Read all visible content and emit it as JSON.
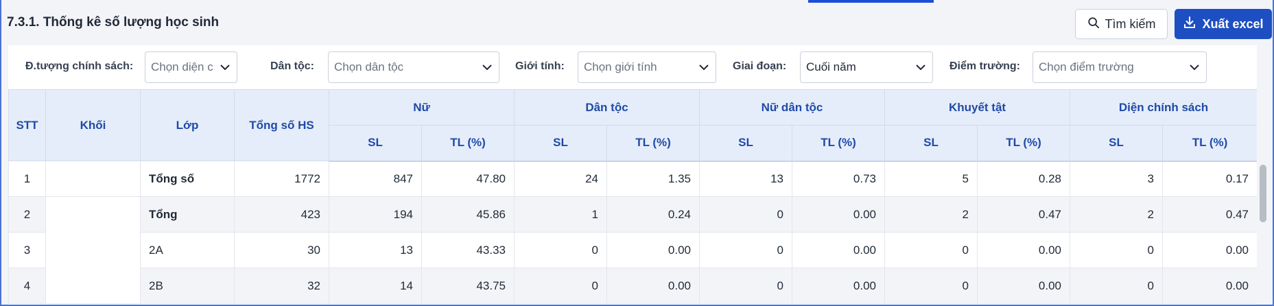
{
  "title": "7.3.1. Thống kê số lượng học sinh",
  "toolbar": {
    "search_label": "Tìm kiếm",
    "export_label": "Xuất excel"
  },
  "filters": {
    "policy": {
      "label": "Đ.tượng chính sách:",
      "placeholder": "Chọn diện ch"
    },
    "ethnic": {
      "label": "Dân tộc:",
      "placeholder": "Chọn dân tộc"
    },
    "gender": {
      "label": "Giới tính:",
      "placeholder": "Chọn giới tính"
    },
    "stage": {
      "label": "Giai đoạn:",
      "value": "Cuối năm"
    },
    "campus": {
      "label": "Điểm trường:",
      "placeholder": "Chọn điểm trường"
    }
  },
  "table": {
    "headers": {
      "stt": "STT",
      "khoi": "Khối",
      "lop": "Lớp",
      "tong_hs": "Tổng số HS",
      "groups": [
        "Nữ",
        "Dân tộc",
        "Nữ dân tộc",
        "Khuyết tật",
        "Diện chính sách"
      ],
      "sl": "SL",
      "tl": "TL (%)"
    },
    "rows": [
      {
        "stt": "1",
        "khoi": "",
        "lop": "Tổng số",
        "tong": "1772",
        "nu_sl": "847",
        "nu_tl": "47.80",
        "dt_sl": "24",
        "dt_tl": "1.35",
        "ndt_sl": "13",
        "ndt_tl": "0.73",
        "kt_sl": "5",
        "kt_tl": "0.28",
        "cs_sl": "3",
        "cs_tl": "0.17"
      },
      {
        "stt": "2",
        "khoi": "",
        "lop": "Tổng",
        "tong": "423",
        "nu_sl": "194",
        "nu_tl": "45.86",
        "dt_sl": "1",
        "dt_tl": "0.24",
        "ndt_sl": "0",
        "ndt_tl": "0.00",
        "kt_sl": "2",
        "kt_tl": "0.47",
        "cs_sl": "2",
        "cs_tl": "0.47"
      },
      {
        "stt": "3",
        "khoi": "",
        "lop": "2A",
        "tong": "30",
        "nu_sl": "13",
        "nu_tl": "43.33",
        "dt_sl": "0",
        "dt_tl": "0.00",
        "ndt_sl": "0",
        "ndt_tl": "0.00",
        "kt_sl": "0",
        "kt_tl": "0.00",
        "cs_sl": "0",
        "cs_tl": "0.00"
      },
      {
        "stt": "4",
        "khoi": "",
        "lop": "2B",
        "tong": "32",
        "nu_sl": "14",
        "nu_tl": "43.75",
        "dt_sl": "0",
        "dt_tl": "0.00",
        "ndt_sl": "0",
        "ndt_tl": "0.00",
        "kt_sl": "0",
        "kt_tl": "0.00",
        "cs_sl": "0",
        "cs_tl": "0.00"
      }
    ]
  },
  "colors": {
    "accent": "#1e4fc2",
    "header_bg": "#e6edfa",
    "header_text": "#1e4aa8"
  }
}
